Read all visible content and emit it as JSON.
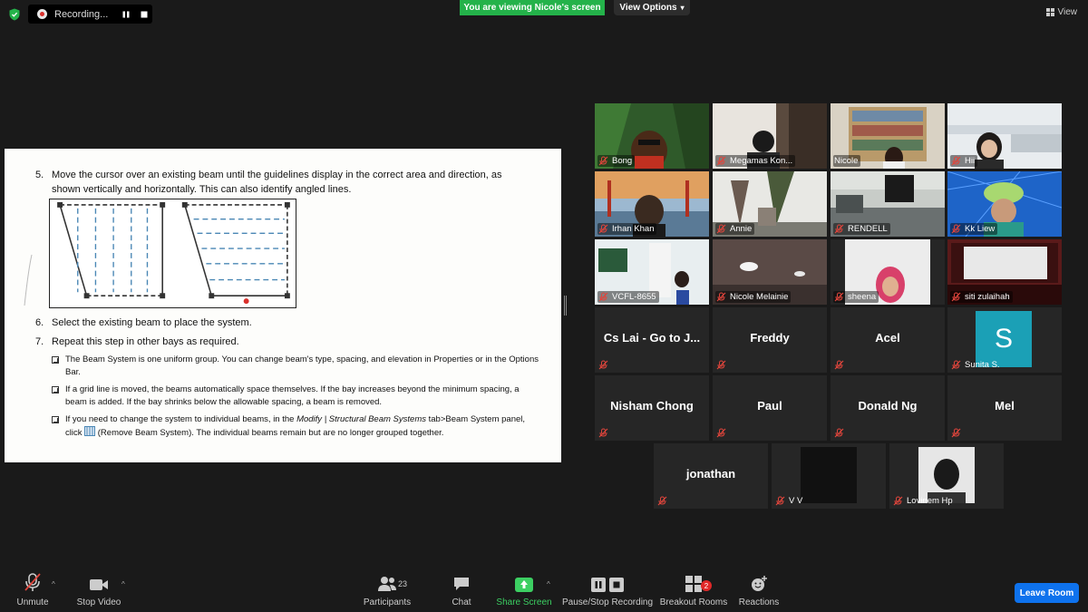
{
  "top": {
    "recording_label": "Recording...",
    "viewing_banner": "You are viewing Nicole's screen",
    "view_options_label": "View Options",
    "view_label": "View"
  },
  "doc": {
    "step5_num": "5.",
    "step5_line1": "Move the cursor over an existing beam until the guidelines display in the correct area and direction, as",
    "step5_line2": "shown vertically and horizontally. This can also identify angled lines.",
    "step6_num": "6.",
    "step6": "Select the existing beam to place the system.",
    "step7_num": "7.",
    "step7": "Repeat this step in other bays as required.",
    "bullet1": "The Beam System is one uniform group. You can change beam's type, spacing, and elevation in Properties or in the Options Bar.",
    "bullet2": "If a grid line is moved, the beams automatically space themselves. If the bay increases beyond the minimum spacing, a beam is added. If the bay shrinks below the allowable spacing, a beam is removed.",
    "bullet3_a": "If you need to change the system to individual beams, in the ",
    "bullet3_italic": "Modify | Structural Beam Systems",
    "bullet3_b": " tab>Beam System panel, click ",
    "bullet3_c": " (Remove Beam System). The individual beams remain but are no longer grouped together."
  },
  "participants": [
    {
      "name": "Bong"
    },
    {
      "name": "Megamas Kon..."
    },
    {
      "name": "Nicole"
    },
    {
      "name": "Hii"
    },
    {
      "name": "Irhan Khan"
    },
    {
      "name": "Annie"
    },
    {
      "name": "RENDELL"
    },
    {
      "name": "Kk Liew"
    },
    {
      "name": "VCFL-8655"
    },
    {
      "name": "Nicole Melainie"
    },
    {
      "name": "sheena"
    },
    {
      "name": "siti zulaihah"
    },
    {
      "name": "Cs Lai - Go to J..."
    },
    {
      "name": "Freddy"
    },
    {
      "name": "Acel"
    },
    {
      "name": "Sunita S.",
      "avatar_letter": "S"
    },
    {
      "name": "Nisham Chong"
    },
    {
      "name": "Paul"
    },
    {
      "name": "Donald Ng"
    },
    {
      "name": "Mel"
    },
    {
      "name": "jonathan"
    },
    {
      "name": "V V"
    },
    {
      "name": "Lovinem Hp"
    }
  ],
  "toolbar": {
    "unmute": "Unmute",
    "stop_video": "Stop Video",
    "participants": "Participants",
    "participant_count": "23",
    "chat": "Chat",
    "share_screen": "Share Screen",
    "pause_stop": "Pause/Stop Recording",
    "breakout": "Breakout Rooms",
    "breakout_badge": "2",
    "reactions": "Reactions",
    "leave": "Leave Room"
  },
  "colors": {
    "accent_green": "#24b24a",
    "leave_blue": "#0e72ed",
    "active_speaker": "#d8f04a",
    "avatar_teal": "#1ba0b6"
  }
}
